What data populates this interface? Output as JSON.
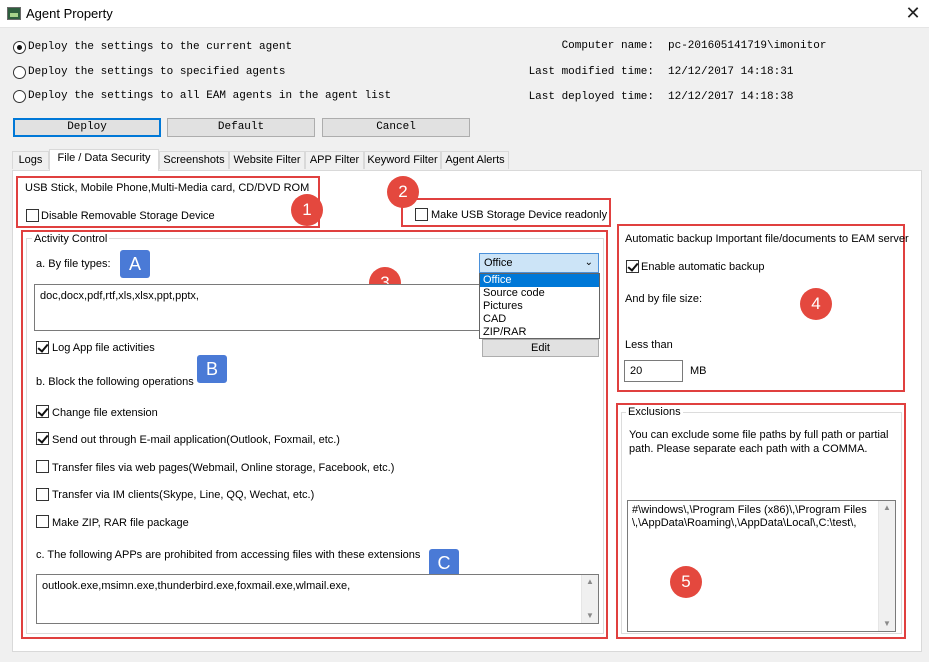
{
  "window": {
    "title": "Agent Property",
    "close_glyph": "✕"
  },
  "deploy_options": [
    {
      "label": "Deploy the settings to the current agent",
      "selected": true
    },
    {
      "label": "Deploy the settings to specified agents",
      "selected": false
    },
    {
      "label": "Deploy the settings to all EAM agents in the agent list",
      "selected": false
    }
  ],
  "info": {
    "computer_name_label": "Computer name:",
    "computer_name": "pc-201605141719\\imonitor",
    "last_modified_label": "Last modified time:",
    "last_modified": "12/12/2017 14:18:31",
    "last_deployed_label": "Last deployed time:",
    "last_deployed": "12/12/2017 14:18:38"
  },
  "buttons": {
    "deploy": "Deploy",
    "default": "Default",
    "cancel": "Cancel"
  },
  "tabs": [
    {
      "label": "Logs",
      "active": false
    },
    {
      "label": "File / Data Security",
      "active": true
    },
    {
      "label": "Screenshots",
      "active": false
    },
    {
      "label": "Website Filter",
      "active": false
    },
    {
      "label": "APP Filter",
      "active": false
    },
    {
      "label": "Keyword Filter",
      "active": false
    },
    {
      "label": "Agent Alerts",
      "active": false
    }
  ],
  "removable": {
    "devices_text": "USB Stick, Mobile Phone,Multi-Media card, CD/DVD ROM",
    "disable_label": "Disable Removable Storage Device",
    "disable_checked": false,
    "usb_readonly_label": "Make USB Storage Device readonly",
    "usb_readonly_checked": false
  },
  "activity": {
    "title": "Activity Control",
    "file_types_label": "a. By file types:",
    "file_type_selected": "Office",
    "file_type_options": [
      "Office",
      "Source code",
      "Pictures",
      "CAD",
      "ZIP/RAR"
    ],
    "extensions": "doc,docx,pdf,rtf,xls,xlsx,ppt,pptx,",
    "edit_button": "Edit",
    "log_app_label": "Log App file activities",
    "log_app_checked": true,
    "block_label": "b. Block the following operations",
    "operations": [
      {
        "label": "Change file extension",
        "checked": true
      },
      {
        "label": "Send out through E-mail application(Outlook, Foxmail, etc.)",
        "checked": true
      },
      {
        "label": "Transfer files via web pages(Webmail, Online storage, Facebook, etc.)",
        "checked": false
      },
      {
        "label": "Transfer via IM clients(Skype, Line, QQ, Wechat, etc.)",
        "checked": false
      },
      {
        "label": "Make ZIP, RAR file package",
        "checked": false
      }
    ],
    "prohibited_label": "c. The following APPs are prohibited from accessing files with these extensions",
    "prohibited_apps": "outlook.exe,msimn.exe,thunderbird.exe,foxmail.exe,wlmail.exe,"
  },
  "backup": {
    "title": "Automatic backup Important file/documents to EAM server",
    "enable_label": "Enable automatic backup",
    "enable_checked": true,
    "size_label": "And by file size:",
    "less_than_label": "Less than",
    "size_value": "20",
    "unit": "MB"
  },
  "exclusions": {
    "title": "Exclusions",
    "description": "You can exclude some file paths by full path or partial path. Please separate each path with a COMMA.",
    "paths_line1": "#\\windows\\,\\Program Files (x86)\\,\\Program Files",
    "paths_line2": "\\,\\AppData\\Roaming\\,\\AppData\\Local\\,C:\\test\\,"
  },
  "annotations": {
    "numbers": [
      "1",
      "2",
      "3",
      "4",
      "5"
    ],
    "letters": [
      "A",
      "B",
      "C"
    ],
    "red": "#e4483e",
    "blue": "#4a7ad6"
  }
}
